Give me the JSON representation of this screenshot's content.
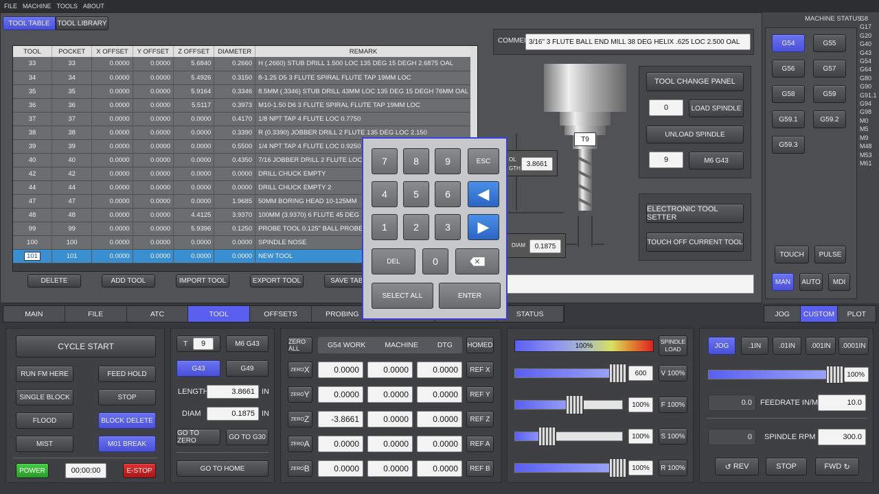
{
  "menu": [
    "FILE",
    "MACHINE",
    "TOOLS",
    "ABOUT"
  ],
  "toptabs": [
    "TOOL TABLE",
    "TOOL LIBRARY"
  ],
  "table": {
    "headers": [
      "TOOL",
      "POCKET",
      "X OFFSET",
      "Y OFFSET",
      "Z OFFSET",
      "DIAMETER",
      "REMARK"
    ],
    "rows": [
      [
        "33",
        "33",
        "0.0000",
        "0.0000",
        "5.6840",
        "0.2660",
        "H (.2660) STUB DRILL 1.500 LOC 135 DEG 15 DEGH 2.6875 OAL"
      ],
      [
        "34",
        "34",
        "0.0000",
        "0.0000",
        "5.4926",
        "0.3150",
        "8-1.25 D5 3 FLUTE SPIRAL FLUTE TAP 19MM LOC"
      ],
      [
        "35",
        "35",
        "0.0000",
        "0.0000",
        "5.9164",
        "0.3346",
        "8.5MM (.3346) STUB DRILL 43MM LOC 135 DEG 15 DEGH 76MM OAL"
      ],
      [
        "36",
        "36",
        "0.0000",
        "0.0000",
        "5.5117",
        "0.3973",
        "M10-1.50 D6 3 FLUTE SPIRAL FLUTE TAP 19MM LOC"
      ],
      [
        "37",
        "37",
        "0.0000",
        "0.0000",
        "0.0000",
        "0.4170",
        "1/8 NPT TAP 4 FLUTE LOC 0.7750"
      ],
      [
        "38",
        "38",
        "0.0000",
        "0.0000",
        "0.0000",
        "0.3390",
        "R (0.3390) JOBBER DRILL 2 FLUTE 135 DEG LOC 2.150"
      ],
      [
        "39",
        "39",
        "0.0000",
        "0.0000",
        "0.0000",
        "0.5500",
        "1/4 NPT TAP 4 FLUTE LOC 0.9250"
      ],
      [
        "40",
        "40",
        "0.0000",
        "0.0000",
        "0.0000",
        "0.4350",
        "7/16 JOBBER DRILL 2 FLUTE LOC"
      ],
      [
        "42",
        "42",
        "0.0000",
        "0.0000",
        "0.0000",
        "0.0000",
        "DRILL CHUCK EMPTY"
      ],
      [
        "44",
        "44",
        "0.0000",
        "0.0000",
        "0.0000",
        "0.0000",
        "DRILL CHUCK EMPTY 2"
      ],
      [
        "47",
        "47",
        "0.0000",
        "0.0000",
        "0.0000",
        "1.9685",
        "50MM BORING HEAD 10-125MM"
      ],
      [
        "48",
        "48",
        "0.0000",
        "0.0000",
        "4.4125",
        "3.9370",
        "100MM (3.9370) 6 FLUTE 45 DEG"
      ],
      [
        "99",
        "99",
        "0.0000",
        "0.0000",
        "5.9396",
        "0.1250",
        "PROBE TOOL 0.125\" BALL PROBE"
      ],
      [
        "100",
        "100",
        "0.0000",
        "0.0000",
        "0.0000",
        "0.0000",
        "SPINDLE NOSE"
      ],
      [
        "101",
        "101",
        "0.0000",
        "0.0000",
        "0.0000",
        "0.0000",
        "NEW TOOL"
      ]
    ]
  },
  "table_buttons": [
    "DELETE",
    "ADD TOOL",
    "IMPORT TOOL",
    "EXPORT TOOL",
    "SAVE TABLE"
  ],
  "comment": {
    "label": "COMMENT",
    "value": "3/16\" 3 FLUTE BALL END MILL 38 DEG HELIX .625 LOC 2.500 OAL"
  },
  "tool_graphic": {
    "tag": "T9",
    "length_label": "OL GTH",
    "length": "3.8661",
    "diam_label": "DIAM",
    "diam": "0.1875"
  },
  "tool_change": {
    "title": "TOOL CHANGE PANEL",
    "load_val": "0",
    "load": "LOAD SPINDLE",
    "unload": "UNLOAD SPINDLE",
    "m6_val": "9",
    "m6": "M6 G43"
  },
  "setter": {
    "title": "ELECTRONIC TOOL SETTER",
    "touch_off": "TOUCH OFF CURRENT TOOL"
  },
  "status": {
    "title": "MACHINE STATUS:",
    "codes": [
      "G8",
      "G17",
      "G20",
      "G40",
      "G43",
      "G54",
      "G64",
      "G80",
      "G90",
      "G91.1",
      "G94",
      "G98",
      "M0",
      "M5",
      "M9",
      "M48",
      "M53",
      "M61"
    ]
  },
  "wcs": [
    "G54",
    "G55",
    "G56",
    "G57",
    "G58",
    "G59",
    "G59.1",
    "G59.2",
    "G59.3"
  ],
  "touch": "TOUCH",
  "pulse": "PULSE",
  "modes": [
    "MAN",
    "AUTO",
    "MDI"
  ],
  "keypad": {
    "keys": [
      "7",
      "8",
      "9",
      "ESC",
      "4",
      "5",
      "6",
      "1",
      "2",
      "3",
      "DEL",
      "0"
    ],
    "select_all": "SELECT ALL",
    "enter": "ENTER"
  },
  "main_tabs": [
    "MAIN",
    "FILE",
    "ATC",
    "TOOL",
    "OFFSETS",
    "PROBING",
    "",
    "",
    "STATUS"
  ],
  "right_tabs": [
    "JOG",
    "CUSTOM",
    "PLOT"
  ],
  "controls": {
    "cycle_start": "CYCLE START",
    "run_from": "RUN FM HERE",
    "feed_hold": "FEED HOLD",
    "single_block": "SINGLE BLOCK",
    "stop": "STOP",
    "flood": "FLOOD",
    "block_delete": "BLOCK DELETE",
    "mist": "MIST",
    "m01": "M01 BREAK",
    "power": "POWER",
    "timer": "00:00:00",
    "estop": "E-STOP"
  },
  "toolpanel": {
    "t": "T",
    "t_val": "9",
    "m6": "M6 G43",
    "g43": "G43",
    "g49": "G49",
    "length_label": "LENGTH",
    "length": "3.8661",
    "unit": "IN",
    "diam_label": "DIAM",
    "diam": "0.1875",
    "go_zero": "GO TO ZERO",
    "go_g30": "GO TO G30",
    "go_home": "GO TO HOME"
  },
  "dro": {
    "zero_all": "ZERO ALL",
    "cols": [
      "G54 WORK",
      "MACHINE",
      "DTG"
    ],
    "homed": "HOMED",
    "axes": [
      {
        "zero": "ZERO",
        "axis": "X",
        "work": "0.0000",
        "machine": "0.0000",
        "dtg": "0.0000",
        "ref": "REF X"
      },
      {
        "zero": "ZERO",
        "axis": "Y",
        "work": "0.0000",
        "machine": "0.0000",
        "dtg": "0.0000",
        "ref": "REF Y"
      },
      {
        "zero": "ZERO",
        "axis": "Z",
        "work": "-3.8661",
        "machine": "0.0000",
        "dtg": "0.0000",
        "ref": "REF Z"
      },
      {
        "zero": "ZERO",
        "axis": "A",
        "work": "0.0000",
        "machine": "0.0000",
        "dtg": "0.0000",
        "ref": "REF A"
      },
      {
        "zero": "ZERO",
        "axis": "B",
        "work": "0.0000",
        "machine": "0.0000",
        "dtg": "0.0000",
        "ref": "REF B"
      }
    ]
  },
  "overrides": {
    "load": "100%",
    "load_label": "SPINDLE LOAD",
    "load_frac": 1.0,
    "rows": [
      {
        "val": "600",
        "btn": "V 100%",
        "frac": 0.95
      },
      {
        "val": "100%",
        "btn": "F 100%",
        "frac": 0.55
      },
      {
        "val": "100%",
        "btn": "S 100%",
        "frac": 0.3
      },
      {
        "val": "100%",
        "btn": "R 100%",
        "frac": 0.95
      }
    ]
  },
  "jog": {
    "jog": "JOG",
    "steps": [
      ".1IN",
      ".01IN",
      ".001IN",
      ".0001IN"
    ],
    "pct": "100%",
    "frac": 0.95,
    "feed_act": "0.0",
    "feed_label": "FEEDRATE IN/M",
    "feed": "10.0",
    "rpm_act": "0",
    "rpm_label": "SPINDLE RPM",
    "rpm": "300.0",
    "rev": "REV",
    "stop": "STOP",
    "fwd": "FWD"
  }
}
